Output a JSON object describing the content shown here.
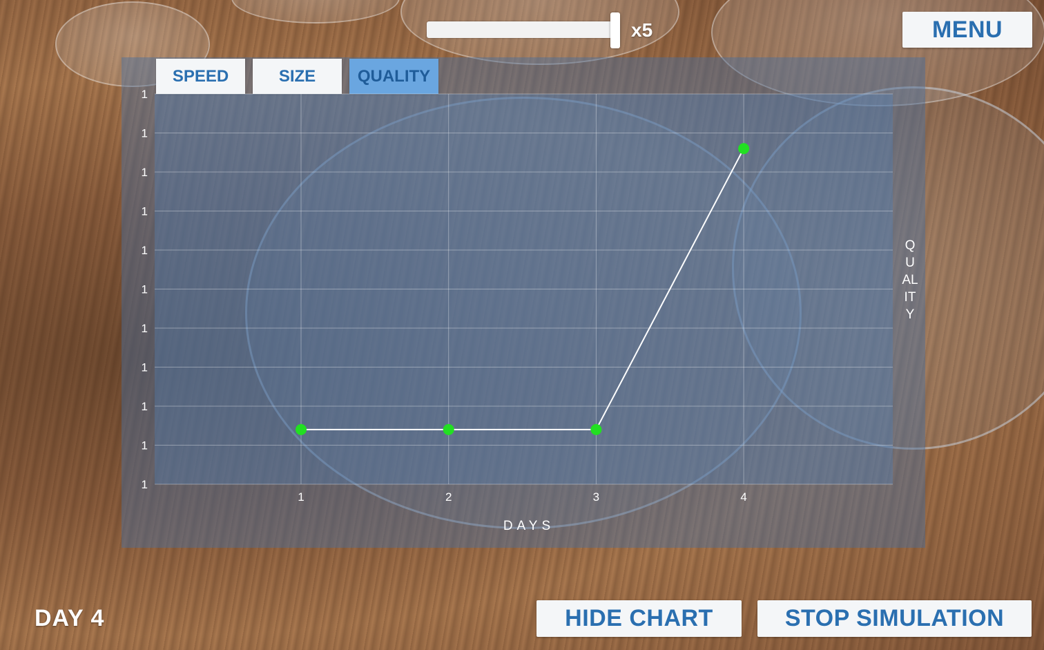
{
  "simulation": {
    "speed_label": "x5",
    "speed_fraction": 0.98,
    "day_label": "DAY 4"
  },
  "buttons": {
    "menu": "MENU",
    "hide_chart": "HIDE CHART",
    "stop_simulation": "STOP SIMULATION"
  },
  "chart": {
    "tabs": [
      {
        "label": "SPEED",
        "active": false
      },
      {
        "label": "SIZE",
        "active": false
      },
      {
        "label": "QUALITY",
        "active": true
      }
    ],
    "x_axis_label": "DAYS",
    "y_axis_label": "QUALITY"
  },
  "colors": {
    "accent": "#2a6fb0",
    "active_tab": "#6aa6e0",
    "point": "#22e022",
    "line": "#ffffff"
  },
  "chart_data": {
    "type": "line",
    "x": [
      1,
      2,
      3,
      4
    ],
    "values": [
      1,
      1,
      1,
      1
    ],
    "plot_y": [
      0.14,
      0.14,
      0.14,
      0.86
    ],
    "x_ticks": [
      "1",
      "2",
      "3",
      "4"
    ],
    "y_ticks": [
      "1",
      "1",
      "1",
      "1",
      "1",
      "1",
      "1",
      "1",
      "1",
      "1",
      "1"
    ],
    "xlabel": "DAYS",
    "ylabel": "QUALITY",
    "grid": true
  }
}
